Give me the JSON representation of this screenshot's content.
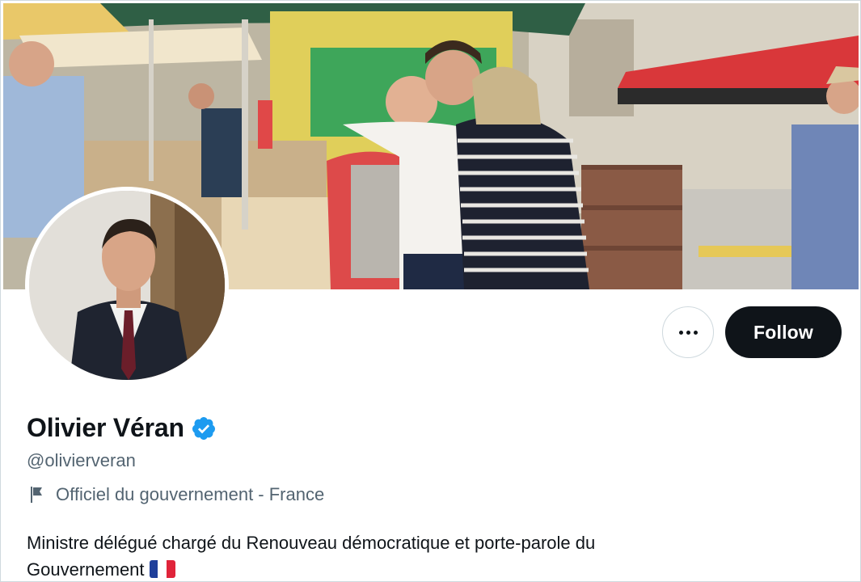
{
  "profile": {
    "display_name": "Olivier Véran",
    "handle": "@olivierveran",
    "verified": true,
    "affiliation": "Officiel du gouvernement - France",
    "bio_line1": "Ministre délégué chargé du Renouveau démocratique et porte-parole du",
    "bio_line2": "Gouvernement",
    "bio_emoji": "french-flag-icon"
  },
  "actions": {
    "more_icon": "more-horizontal-icon",
    "follow_label": "Follow"
  },
  "colors": {
    "primary_text": "#0f1419",
    "secondary_text": "#536471",
    "verified_blue": "#1d9bf0",
    "follow_bg": "#0f1419",
    "border": "#cfd9de"
  },
  "icons": {
    "verified": "verified-badge-icon",
    "affiliation": "flag-icon"
  }
}
